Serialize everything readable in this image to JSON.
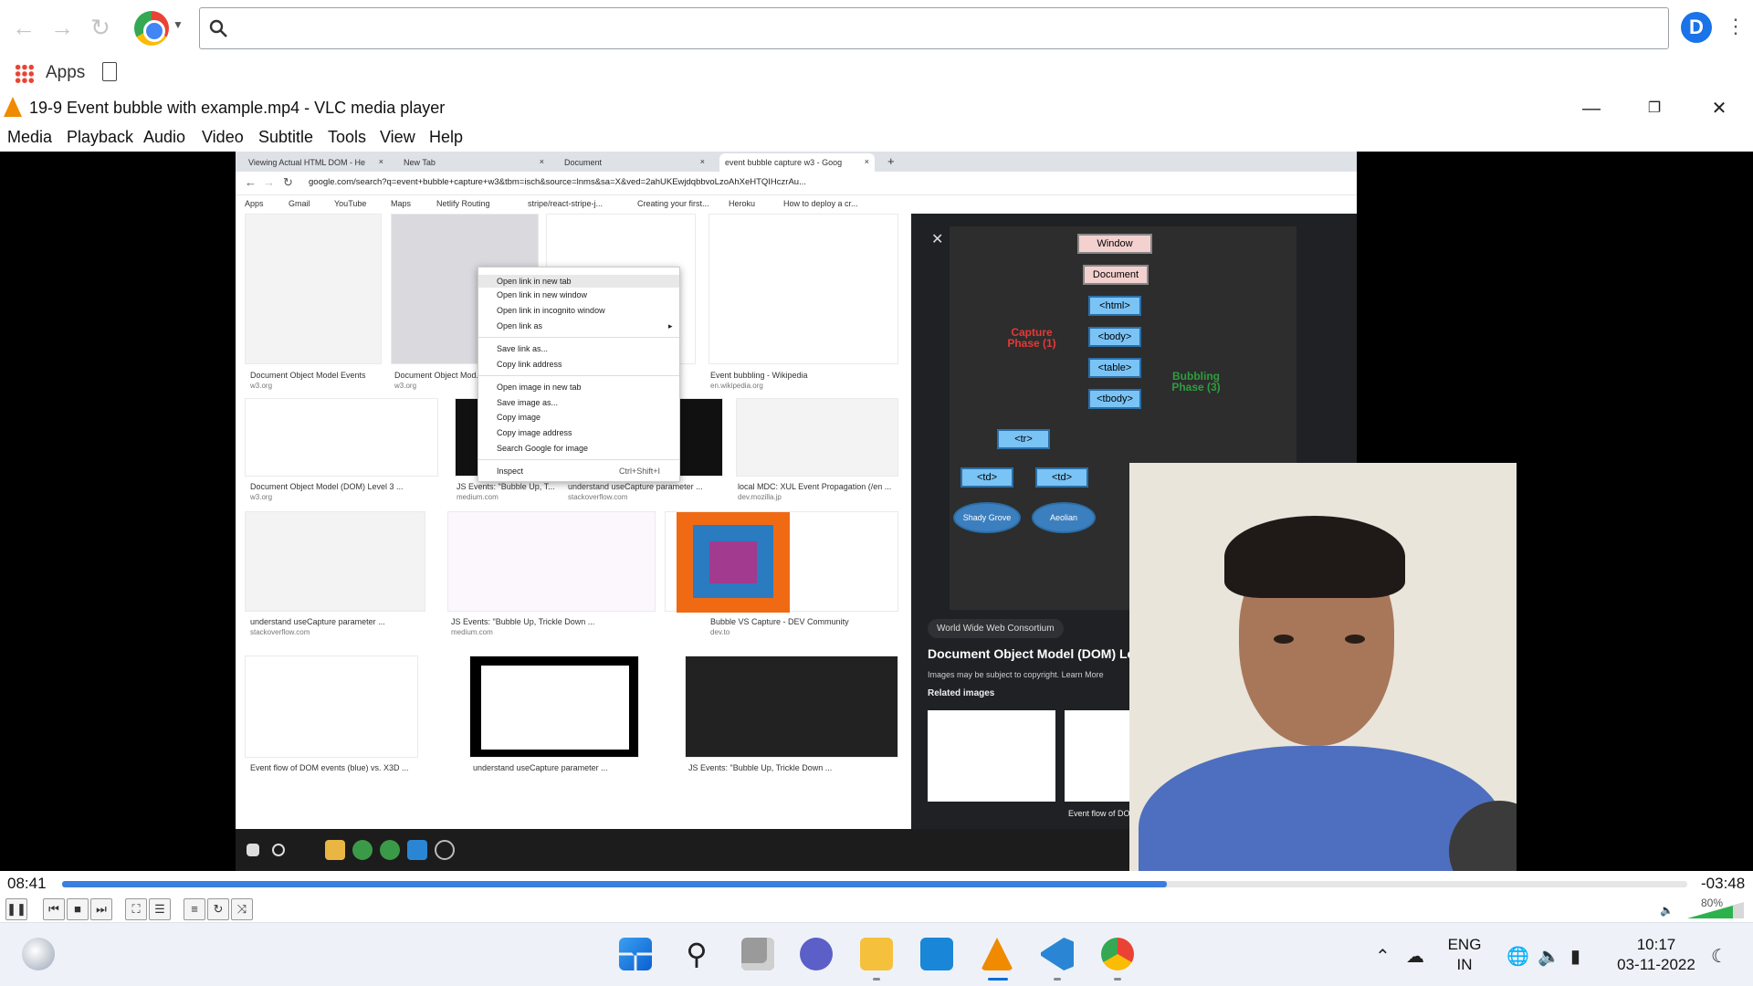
{
  "chrome": {
    "apps_label": "Apps",
    "profile_initial": "D"
  },
  "vlc": {
    "title": "19-9 Event bubble with example.mp4 - VLC media player",
    "menu": [
      "Media",
      "Playback",
      "Audio",
      "Video",
      "Subtitle",
      "Tools",
      "View",
      "Help"
    ],
    "elapsed": "08:41",
    "remaining": "-03:48",
    "progress_fraction": 0.68,
    "volume_label": "80%",
    "volume_fraction": 0.8
  },
  "video_frame": {
    "tabs": [
      {
        "label": "Viewing Actual HTML DOM - He"
      },
      {
        "label": "New Tab"
      },
      {
        "label": "Document"
      },
      {
        "label": "event bubble capture w3 - Goog"
      }
    ],
    "url": "google.com/search?q=event+bubble+capture+w3&tbm=isch&source=lnms&sa=X&ved=2ahUKEwjdqbbvoLzoAhXeHTQIHczrAu...",
    "bookmarks": [
      "Apps",
      "Gmail",
      "YouTube",
      "Maps",
      "Netlify Routing",
      "stripe/react-stripe-j...",
      "Creating your first...",
      "Heroku",
      "How to deploy a cr..."
    ],
    "results": [
      {
        "caption": "Document Object Model Events",
        "source": "w3.org"
      },
      {
        "caption": "Document Object Mod...",
        "source": "w3.org"
      },
      {
        "caption": "Event bubbling - Wikipedia",
        "source": "en.wikipedia.org"
      },
      {
        "caption": "Document Object Model (DOM) Level 3 ...",
        "source": "w3.org"
      },
      {
        "caption": "JS Events: \"Bubble Up, T...",
        "source": "medium.com"
      },
      {
        "caption": "understand useCapture parameter ...",
        "source": "stackoverflow.com"
      },
      {
        "caption": "local MDC: XUL Event Propagation (/en ...",
        "source": "dev.mozilla.jp"
      },
      {
        "caption": "understand useCapture parameter ...",
        "source": "stackoverflow.com"
      },
      {
        "caption": "JS Events: \"Bubble Up, Trickle Down ...",
        "source": "medium.com"
      },
      {
        "caption": "Bubble VS Capture - DEV Community",
        "source": "dev.to"
      },
      {
        "caption": "Event flow of DOM events (blue) vs. X3D ...",
        "source": ""
      },
      {
        "caption": "understand useCapture parameter ...",
        "source": ""
      },
      {
        "caption": "JS Events: \"Bubble Up, Trickle Down ...",
        "source": ""
      }
    ],
    "context_menu": {
      "items": [
        "Open link in new tab",
        "Open link in new window",
        "Open link in incognito window",
        "Open link as",
        "Save link as...",
        "Copy link address",
        "Open image in new tab",
        "Save image as...",
        "Copy image",
        "Copy image address",
        "Search Google for image",
        "Inspect"
      ],
      "inspect_shortcut": "Ctrl+Shift+I"
    },
    "preview": {
      "nodes": [
        "Window",
        "Document",
        "<html>",
        "<body>",
        "<table>",
        "<tbody>",
        "<tr>",
        "<td>",
        "<td>",
        "Shady Grove",
        "Aeolian"
      ],
      "capture_label": "Capture Phase (1)",
      "bubbling_label": "Bubbling Phase (3)",
      "site": "World Wide Web Consortium",
      "title": "Document Object Model (DOM) Le",
      "note": "Images may be subject to copyright. Learn More",
      "related": "Related images",
      "related_caption": "Event flow of DOM"
    }
  },
  "taskbar": {
    "lang_top": "ENG",
    "lang_bottom": "IN",
    "time": "10:17",
    "date": "03-11-2022"
  },
  "colors": {
    "vlc_progress": "#3a7ee0",
    "volume": "#2bb24c",
    "vlc_orange": "#f08a00"
  }
}
